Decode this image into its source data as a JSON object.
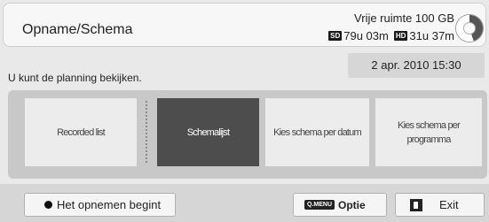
{
  "header": {
    "title": "Opname/Schema",
    "free_space": "Vrije ruimte 100 GB",
    "sd_label": "SD",
    "sd_time": "79u 03m",
    "hd_label": "HD",
    "hd_time": "31u 37m",
    "disk_icon": "disk-usage-icon"
  },
  "date": "2 apr. 2010 15:30",
  "info_text": "U kunt de planning bekijken.",
  "tabs": [
    {
      "label": "Recorded list",
      "active": false
    },
    {
      "label": "Schemalijst",
      "active": true
    },
    {
      "label": "Kies schema per datum",
      "active": false
    },
    {
      "label": "Kies schema per programma",
      "active": false
    }
  ],
  "footer": {
    "record_label": "Het opnemen begint",
    "record_icon": "record-dot-icon",
    "option_key": "Q.MENU",
    "option_label": "Optie",
    "exit_icon": "exit-key-icon",
    "exit_label": "Exit"
  },
  "colors": {
    "active_tab": "#4d4d4d",
    "panel_bg": "#e9e9e9"
  }
}
